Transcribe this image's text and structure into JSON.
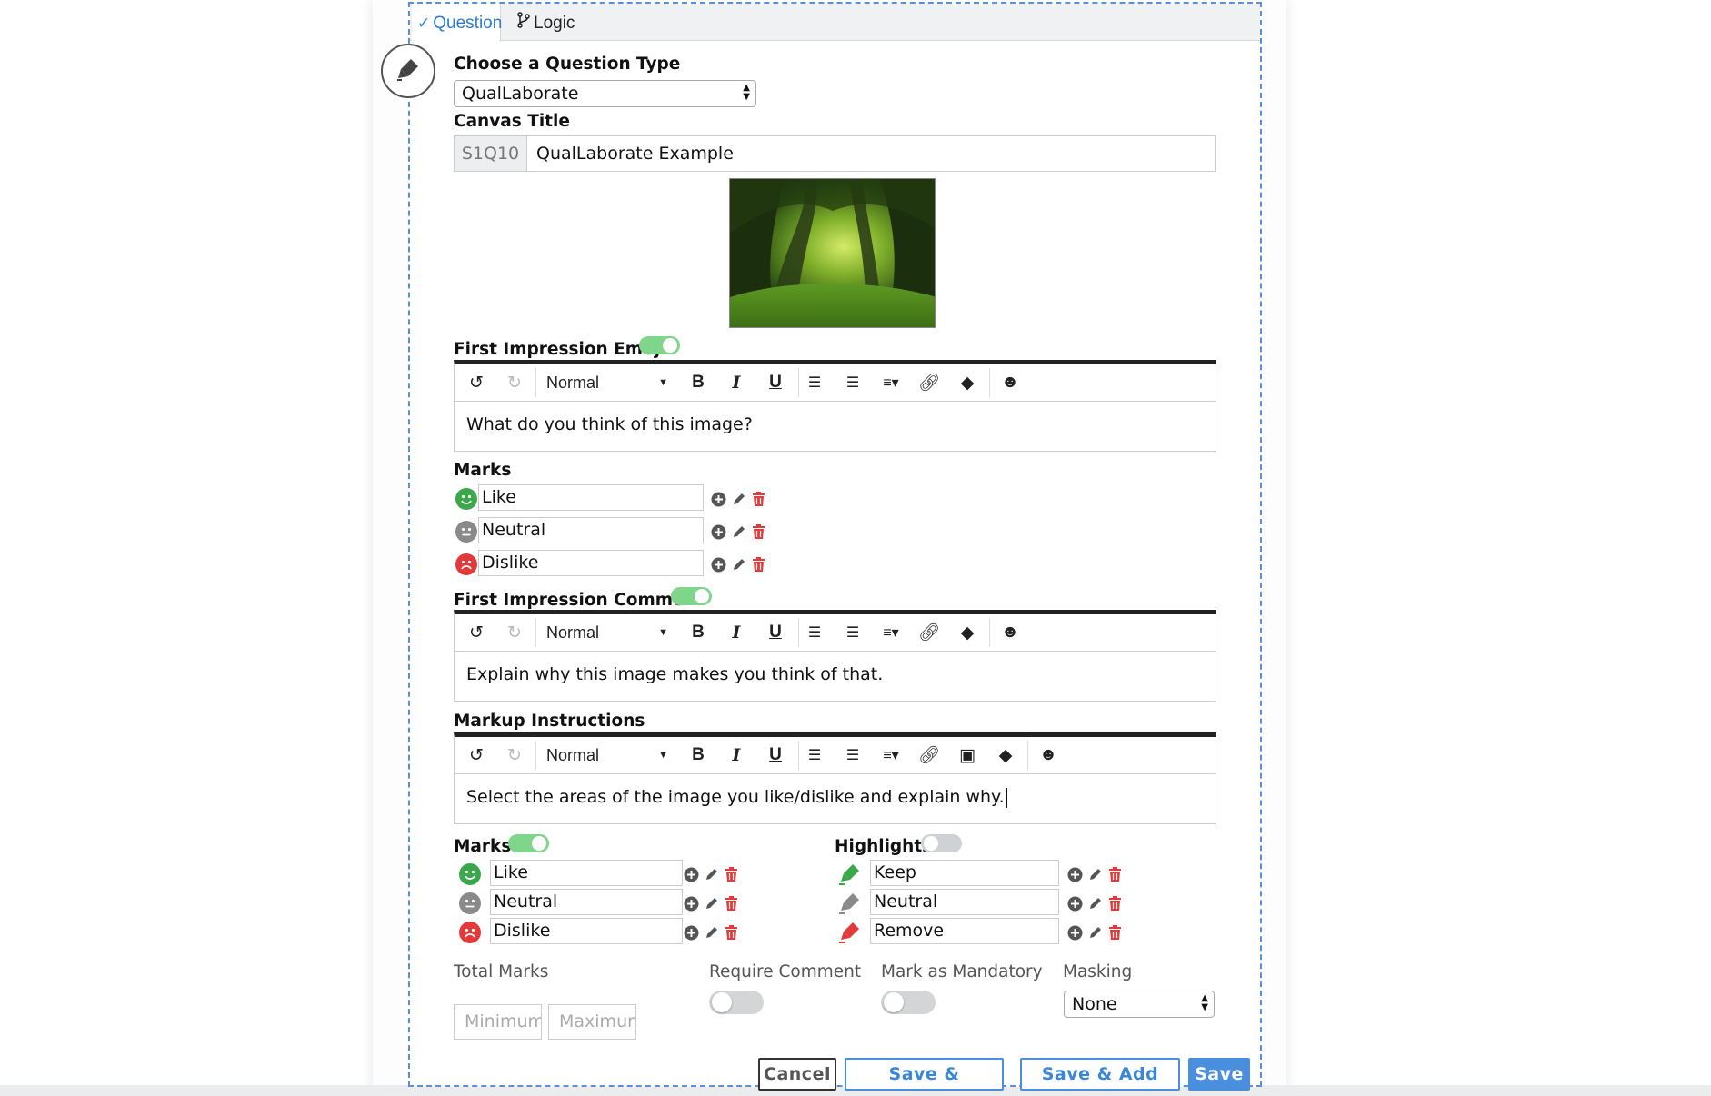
{
  "tabs": [
    {
      "label": "Question",
      "active": true
    },
    {
      "label": "Logic",
      "active": false
    }
  ],
  "question_type": {
    "label": "Choose a Question Type",
    "value": "QualLaborate",
    "icon": "highlighter-icon"
  },
  "canvas_title": {
    "label": "Canvas Title",
    "prefix": "S1Q10",
    "value": "QualLaborate Example"
  },
  "image": {
    "alt": "forest image",
    "colors": {
      "dark": "#14260b",
      "mid": "#3f6b1e",
      "light": "#b9dd4a"
    }
  },
  "first_impression_emoji": {
    "label": "First Impression Emoji",
    "enabled": true,
    "format": "Normal",
    "text": "What do you think of this image?"
  },
  "marks_emoji": {
    "label": "Marks",
    "items": [
      {
        "label": "Like",
        "color": "#3aa84a",
        "icon": "smile-icon"
      },
      {
        "label": "Neutral",
        "color": "#8a8a8a",
        "icon": "neutral-face-icon"
      },
      {
        "label": "Dislike",
        "color": "#e23a3a",
        "icon": "frown-icon"
      }
    ]
  },
  "first_impression_comment": {
    "label": "First Impression Comment",
    "enabled": true,
    "format": "Normal",
    "text": "Explain why this image makes you think of that."
  },
  "markup_instructions": {
    "label": "Markup Instructions",
    "format": "Normal",
    "text": "Select the areas of the image you like/dislike and explain why."
  },
  "marks": {
    "label": "Marks",
    "enabled": true,
    "items": [
      {
        "label": "Like",
        "color": "#3aa84a",
        "icon": "smile-icon"
      },
      {
        "label": "Neutral",
        "color": "#8a8a8a",
        "icon": "neutral-face-icon"
      },
      {
        "label": "Dislike",
        "color": "#e23a3a",
        "icon": "frown-icon"
      }
    ]
  },
  "highlights": {
    "label": "Highlights",
    "enabled": false,
    "items": [
      {
        "label": "Keep",
        "color": "#3aa84a",
        "icon": "highlighter-icon"
      },
      {
        "label": "Neutral",
        "color": "#8a8a8a",
        "icon": "highlighter-icon"
      },
      {
        "label": "Remove",
        "color": "#e23a3a",
        "icon": "highlighter-icon"
      }
    ]
  },
  "options": {
    "total_marks": {
      "label": "Total Marks",
      "min_placeholder": "Minimum",
      "max_placeholder": "Maximum"
    },
    "require_comment": {
      "label": "Require Comment",
      "enabled": false
    },
    "mark_as_mandatory": {
      "label": "Mark as Mandatory",
      "enabled": false
    },
    "masking": {
      "label": "Masking",
      "value": "None"
    }
  },
  "actions": {
    "cancel": "Cancel",
    "save_duplicate": "Save & Duplicate",
    "save_add_new": "Save & Add New",
    "save": "Save"
  },
  "colors": {
    "accent": "#4a8ede",
    "toggle_on": "#7fd68a",
    "like": "#3aa84a",
    "dislike": "#e23a3a",
    "neutral": "#8a8a8a"
  }
}
